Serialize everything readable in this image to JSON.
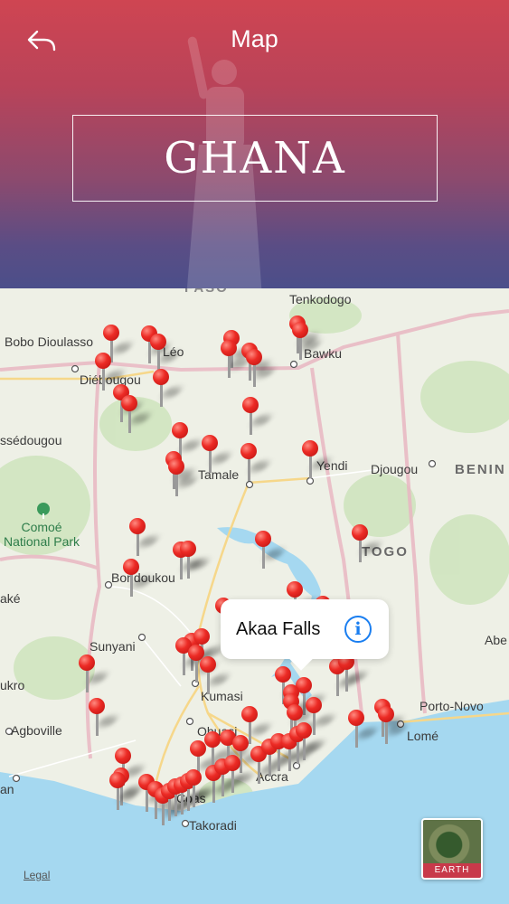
{
  "header": {
    "title": "Map",
    "country": "GHANA"
  },
  "map": {
    "labels": {
      "faso": "FASO",
      "tenkodogo": "Tenkodogo",
      "bobo": "Bobo Dioulasso",
      "leo": "Léo",
      "bawku": "Bawku",
      "diebougou": "Diébougou",
      "tamale": "Tamale",
      "yendi": "Yendi",
      "djougou": "Djougou",
      "benin": "BENIN",
      "essedougou": "ssédougou",
      "comoe": "Comoé\nNational Park",
      "togo": "TOGO",
      "bondoukou": "Bondoukou",
      "ake": "aké",
      "sunyani": "Sunyani",
      "abe": "Abe",
      "kumasi": "Kumasi",
      "porto_novo": "Porto-Novo",
      "ukro": "ukro",
      "agboville": "Agboville",
      "obuasi": "Obuasi",
      "lome": "Lomé",
      "accra": "Accra",
      "coast": "Coas",
      "an": "an",
      "takoradi": "Takoradi"
    },
    "callout": {
      "title": "Akaa Falls",
      "info_symbol": "i"
    },
    "legal": "Legal",
    "earth_button": "EARTH"
  }
}
